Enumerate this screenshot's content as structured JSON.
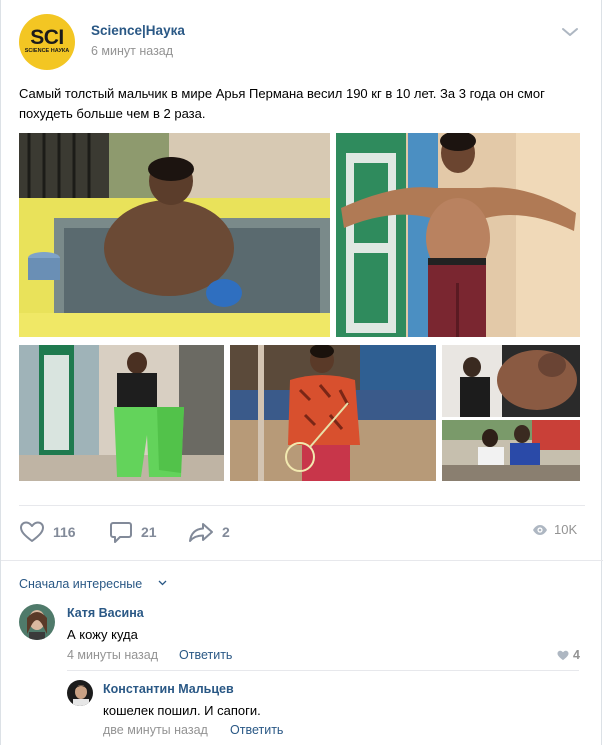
{
  "post": {
    "group_name": "Science|Наука",
    "time": "6 минут назад",
    "logo_main": "SCI",
    "logo_sub": "SCIENCE НАУКА",
    "text": "Самый толстый мальчик в мире Арья Пермана весил 190 кг в 10 лет. За 3 года он смог похудеть больше чем в 2 раза."
  },
  "actions": {
    "likes": "116",
    "comments": "21",
    "shares": "2",
    "views": "10K"
  },
  "comments_sort": "Сначала интересные",
  "comments": [
    {
      "author": "Катя Васина",
      "text": "А кожу куда",
      "time": "4 минуты назад",
      "reply_label": "Ответить",
      "likes": "4"
    },
    {
      "author": "Константин Мальцев",
      "text": "кошелек пошил. И сапоги.",
      "time": "две минуты назад",
      "reply_label": "Ответить"
    }
  ],
  "colors": {
    "link": "#2a5885",
    "muted": "#939393",
    "icon": "#828a99",
    "logo_yellow": "#f3c623"
  }
}
